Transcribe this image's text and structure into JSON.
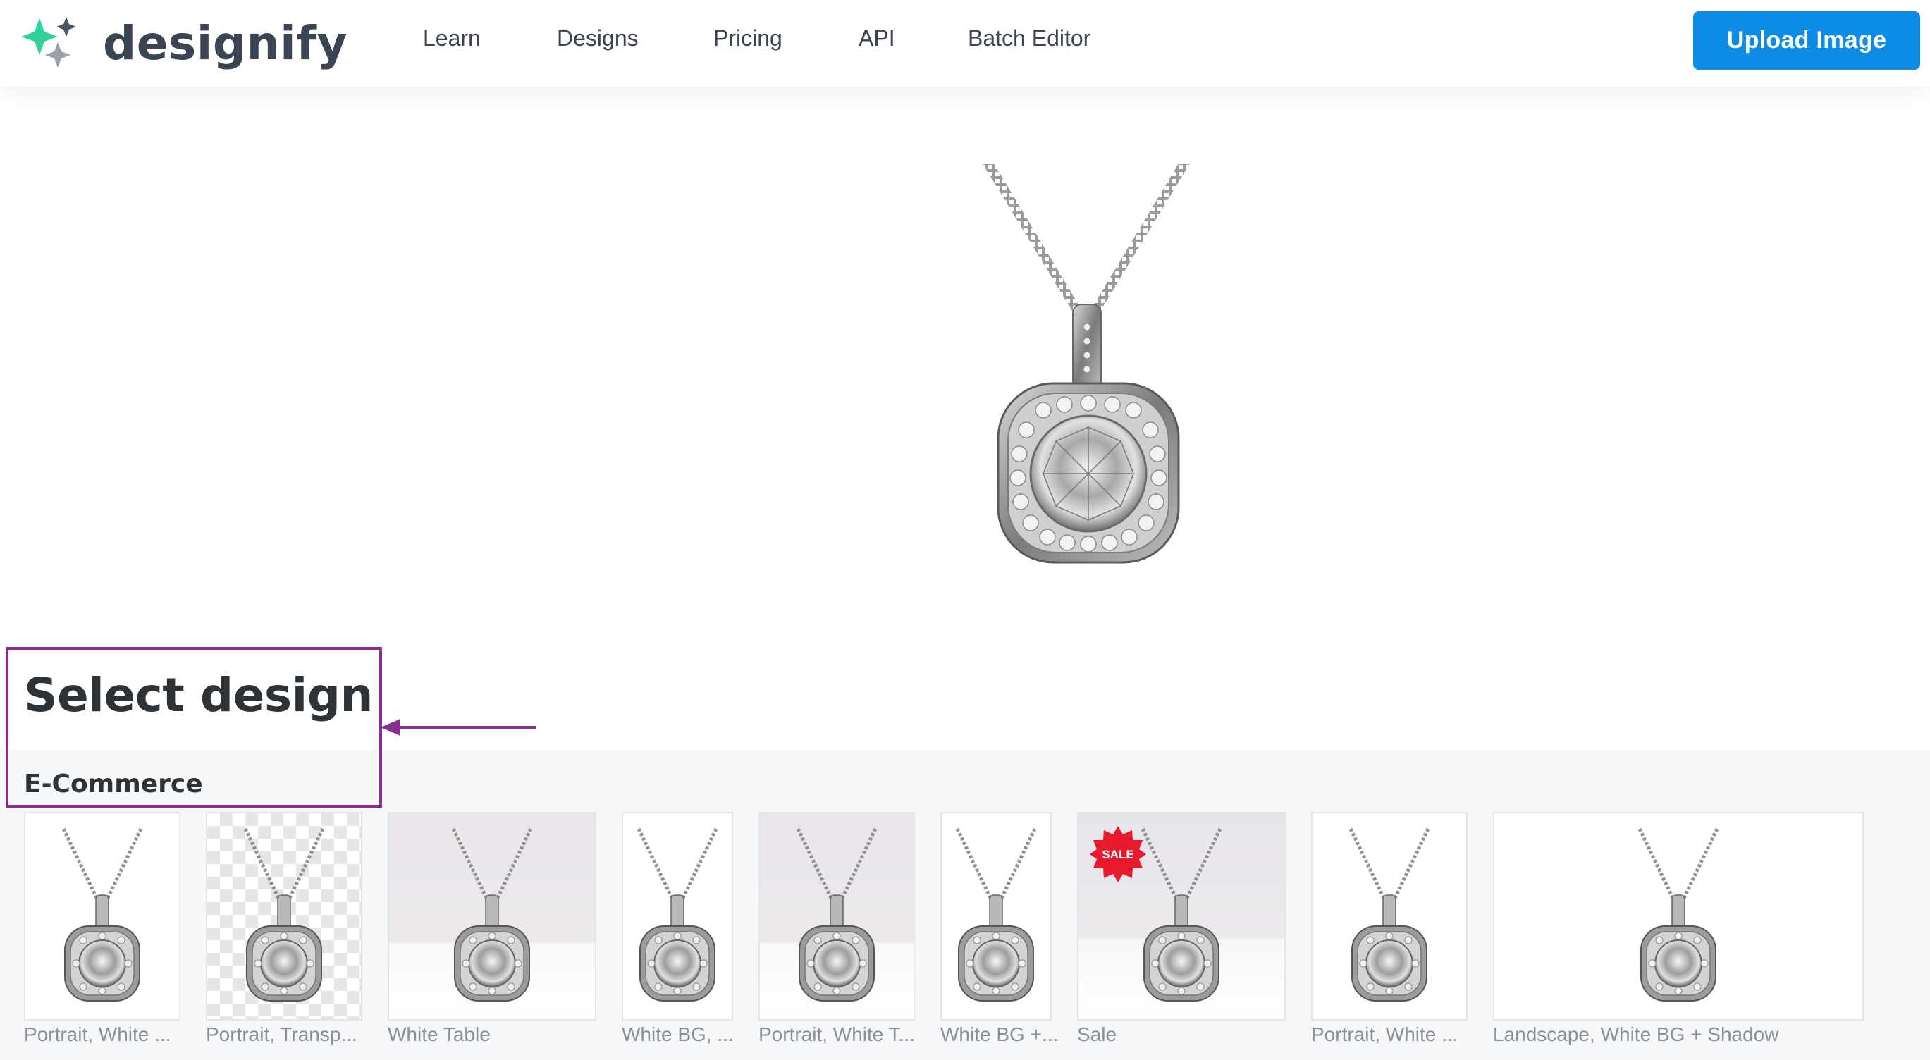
{
  "header": {
    "logo_text": "designify",
    "nav": {
      "learn": "Learn",
      "designs": "Designs",
      "pricing": "Pricing",
      "api": "API",
      "batch_editor": "Batch Editor"
    },
    "upload_label": "Upload Image"
  },
  "colors": {
    "brand_green": "#2ed39a",
    "accent_blue": "#0d8ce6",
    "highlight_purple": "#8a2d92",
    "sale_red": "#e8192c"
  },
  "main": {
    "select_title": "Select design",
    "section_title": "E-Commerce",
    "sale_badge_text": "SALE",
    "designs": [
      {
        "label": "Portrait, White ..."
      },
      {
        "label": "Portrait, Transp..."
      },
      {
        "label": "White Table"
      },
      {
        "label": "White BG, ..."
      },
      {
        "label": "Portrait, White T..."
      },
      {
        "label": "White BG +..."
      },
      {
        "label": "Sale"
      },
      {
        "label": "Portrait, White ..."
      },
      {
        "label": "Landscape, White BG + Shadow"
      }
    ]
  }
}
